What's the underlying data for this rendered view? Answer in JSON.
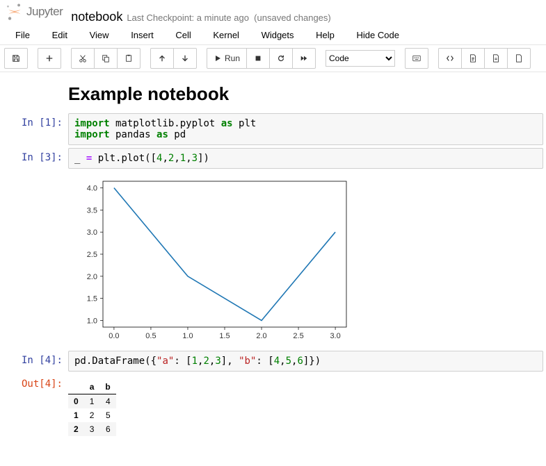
{
  "header": {
    "logo_text": "Jupyter",
    "notebook_name": "notebook",
    "checkpoint": "Last Checkpoint: a minute ago",
    "unsaved": "(unsaved changes)"
  },
  "menu": {
    "file": "File",
    "edit": "Edit",
    "view": "View",
    "insert": "Insert",
    "cell": "Cell",
    "kernel": "Kernel",
    "widgets": "Widgets",
    "help": "Help",
    "hide": "Hide Code"
  },
  "toolbar": {
    "run": "Run",
    "celltype": "Code"
  },
  "title": "Example notebook",
  "cells": {
    "c1": {
      "prompt": "In [1]:",
      "code": {
        "l1a": "import",
        "l1b": " matplotlib.pyplot ",
        "l1c": "as",
        "l1d": " plt",
        "l2a": "import",
        "l2b": " pandas ",
        "l2c": "as",
        "l2d": " pd"
      }
    },
    "c2": {
      "prompt": "In [3]:",
      "code": {
        "a": "_ ",
        "b": "=",
        "c": " plt.plot([",
        "d": "4",
        "e": ",",
        "f": "2",
        "g": ",",
        "h": "1",
        "i": ",",
        "j": "3",
        "k": "])"
      }
    },
    "c3": {
      "prompt": "In [4]:",
      "out_prompt": "Out[4]:",
      "code": {
        "a": "pd.DataFrame({",
        "b": "\"a\"",
        "c": ": [",
        "d": "1",
        "e": ",",
        "f": "2",
        "g": ",",
        "h": "3",
        "i": "], ",
        "j": "\"b\"",
        "k": ": [",
        "l": "4",
        "m": ",",
        "n": "5",
        "o": ",",
        "p": "6",
        "q": "]})"
      }
    }
  },
  "chart_data": {
    "type": "line",
    "x": [
      0,
      1,
      2,
      3
    ],
    "values": [
      4,
      2,
      1,
      3
    ],
    "xticks": [
      "0.0",
      "0.5",
      "1.0",
      "1.5",
      "2.0",
      "2.5",
      "3.0"
    ],
    "yticks": [
      "1.0",
      "1.5",
      "2.0",
      "2.5",
      "3.0",
      "3.5",
      "4.0"
    ],
    "xlim": [
      -0.15,
      3.15
    ],
    "ylim": [
      0.85,
      4.15
    ],
    "title": "",
    "xlabel": "",
    "ylabel": ""
  },
  "dataframe": {
    "columns": [
      "a",
      "b"
    ],
    "index": [
      "0",
      "1",
      "2"
    ],
    "rows": [
      [
        "1",
        "4"
      ],
      [
        "2",
        "5"
      ],
      [
        "3",
        "6"
      ]
    ]
  },
  "icons": {
    "save": "save-icon",
    "add": "plus-icon",
    "cut": "cut-icon",
    "copy": "copy-icon",
    "paste": "paste-icon",
    "up": "up-icon",
    "down": "down-icon",
    "run": "play-icon",
    "stop": "stop-icon",
    "restart": "restart-icon",
    "ff": "fast-forward-icon",
    "cmd": "keyboard-icon",
    "code": "code-icon",
    "file": "file-text-icon",
    "pdf": "file-pdf-icon",
    "dup": "file-icon"
  }
}
